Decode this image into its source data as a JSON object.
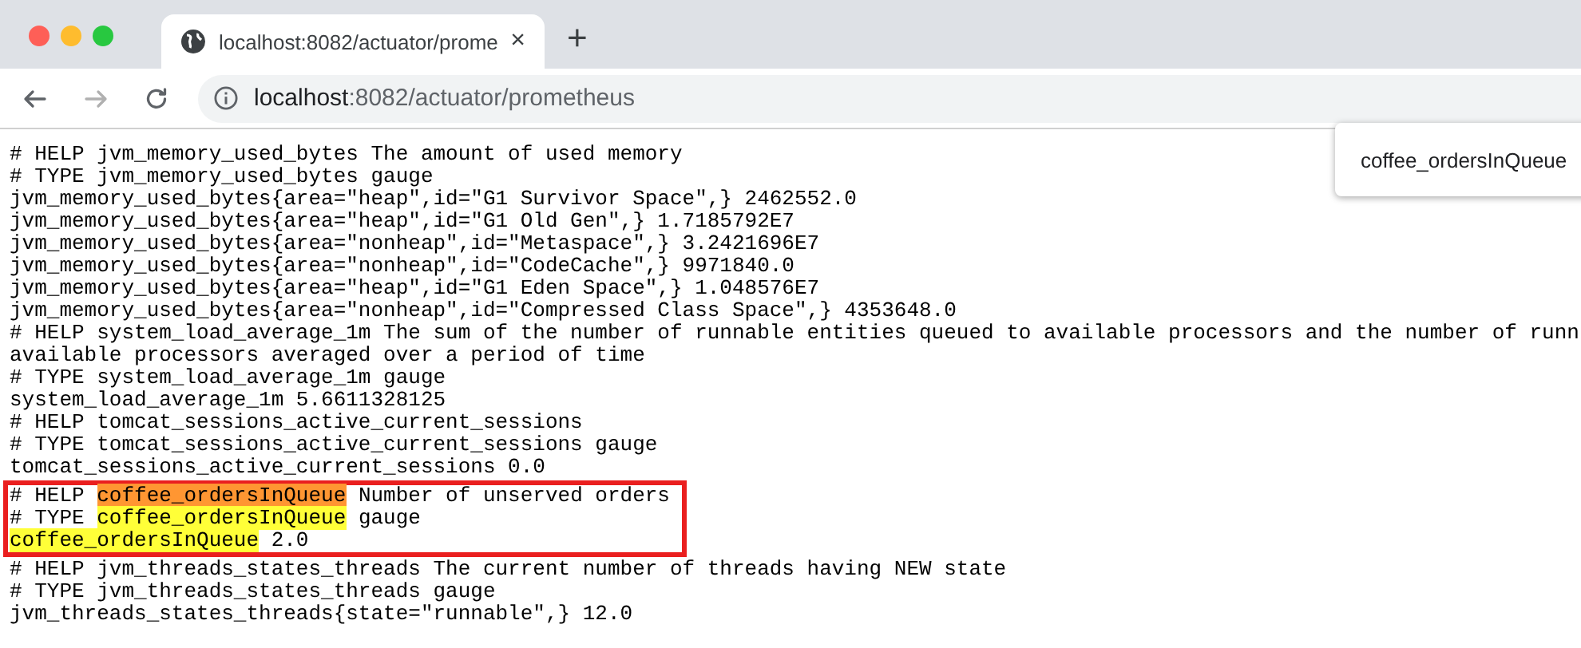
{
  "tabs": [
    {
      "title": "localhost:8082/actuator/prome",
      "close": "×",
      "selected": true
    }
  ],
  "new_tab": "+",
  "toolbar": {
    "back_disabled": false,
    "forward_disabled": true
  },
  "address": {
    "host": "localhost",
    "path": ":8082/actuator/prometheus"
  },
  "find_bar": {
    "value": "coffee_ordersInQueue"
  },
  "lines": [
    {
      "parts": [
        {
          "text": "# HELP jvm_memory_used_bytes The amount of used memory"
        }
      ]
    },
    {
      "parts": [
        {
          "text": "# TYPE jvm_memory_used_bytes gauge"
        }
      ]
    },
    {
      "parts": [
        {
          "text": "jvm_memory_used_bytes{area=\"heap\",id=\"G1 Survivor Space\",} 2462552.0"
        }
      ]
    },
    {
      "parts": [
        {
          "text": "jvm_memory_used_bytes{area=\"heap\",id=\"G1 Old Gen\",} 1.7185792E7"
        }
      ]
    },
    {
      "parts": [
        {
          "text": "jvm_memory_used_bytes{area=\"nonheap\",id=\"Metaspace\",} 3.2421696E7"
        }
      ]
    },
    {
      "parts": [
        {
          "text": "jvm_memory_used_bytes{area=\"nonheap\",id=\"CodeCache\",} 9971840.0"
        }
      ]
    },
    {
      "parts": [
        {
          "text": "jvm_memory_used_bytes{area=\"heap\",id=\"G1 Eden Space\",} 1.048576E7"
        }
      ]
    },
    {
      "parts": [
        {
          "text": "jvm_memory_used_bytes{area=\"nonheap\",id=\"Compressed Class Space\",} 4353648.0"
        }
      ]
    },
    {
      "parts": [
        {
          "text": "# HELP system_load_average_1m The sum of the number of runnable entities queued to available processors and the number of runn"
        }
      ]
    },
    {
      "parts": [
        {
          "text": "available processors averaged over a period of time"
        }
      ]
    },
    {
      "parts": [
        {
          "text": "# TYPE system_load_average_1m gauge"
        }
      ]
    },
    {
      "parts": [
        {
          "text": "system_load_average_1m 5.6611328125"
        }
      ]
    },
    {
      "parts": [
        {
          "text": "# HELP tomcat_sessions_active_current_sessions"
        }
      ]
    },
    {
      "parts": [
        {
          "text": "# TYPE tomcat_sessions_active_current_sessions gauge"
        }
      ]
    },
    {
      "parts": [
        {
          "text": "tomcat_sessions_active_current_sessions 0.0"
        }
      ]
    },
    {
      "boxed": true,
      "parts": [
        {
          "text": "# HELP "
        },
        {
          "text": "coffee_ordersInQueue",
          "highlight": true,
          "current": true
        },
        {
          "text": " Number of unserved orders"
        }
      ]
    },
    {
      "boxed": true,
      "parts": [
        {
          "text": "# TYPE "
        },
        {
          "text": "coffee_ordersInQueue",
          "highlight": true,
          "current": false
        },
        {
          "text": " gauge"
        }
      ]
    },
    {
      "boxed": true,
      "parts": [
        {
          "text": "coffee_ordersInQueue",
          "highlight": true,
          "current": false
        },
        {
          "text": " 2.0"
        }
      ]
    },
    {
      "parts": [
        {
          "text": "# HELP jvm_threads_states_threads The current number of threads having NEW state"
        }
      ]
    },
    {
      "parts": [
        {
          "text": "# TYPE jvm_threads_states_threads gauge"
        }
      ]
    },
    {
      "parts": [
        {
          "text": "jvm_threads_states_threads{state=\"runnable\",} 12.0"
        }
      ]
    }
  ]
}
